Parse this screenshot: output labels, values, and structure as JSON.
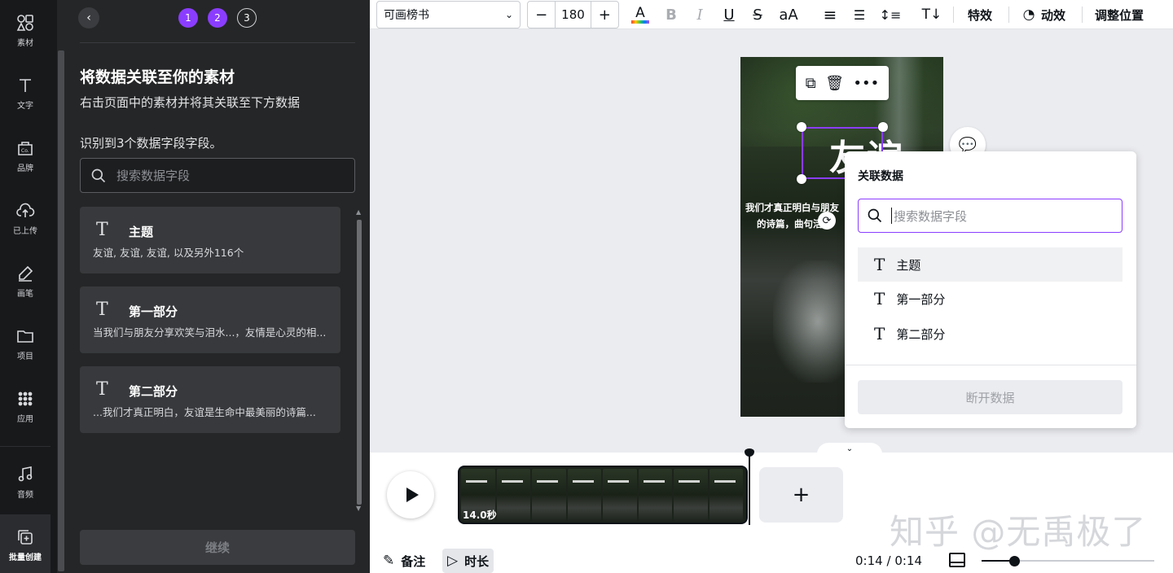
{
  "rail": {
    "items": [
      {
        "label": "素材",
        "icon": "elements-icon"
      },
      {
        "label": "文字",
        "icon": "text-icon"
      },
      {
        "label": "品牌",
        "icon": "brand-icon"
      },
      {
        "label": "已上传",
        "icon": "upload-icon"
      },
      {
        "label": "画笔",
        "icon": "draw-icon"
      },
      {
        "label": "项目",
        "icon": "folder-icon"
      },
      {
        "label": "应用",
        "icon": "apps-icon"
      },
      {
        "label": "音频",
        "icon": "music-icon"
      },
      {
        "label": "批量创建",
        "icon": "bulk-create-icon"
      }
    ]
  },
  "panel": {
    "steps": [
      "1",
      "2",
      "3"
    ],
    "current_step": 2,
    "title": "将数据关联至你的素材",
    "subtitle": "右击页面中的素材并将其关联至下方数据",
    "count_text": "识别到3个数据字段字段。",
    "search_placeholder": "搜索数据字段",
    "fields": [
      {
        "name": "主题",
        "values": "友谊, 友谊, 友谊, 以及另外116个"
      },
      {
        "name": "第一部分",
        "values": "当我们与朋友分享欢笑与泪水...，友情是心灵的相..."
      },
      {
        "name": "第二部分",
        "values": "...我们才真正明白，友谊是生命中最美丽的诗篇..."
      }
    ],
    "continue_label": "继续"
  },
  "toolbar": {
    "font_name": "可画榜书",
    "font_size": "180",
    "minus": "−",
    "plus": "+",
    "effects_label": "特效",
    "animate_label": "动效",
    "position_label": "调整位置"
  },
  "canvas": {
    "title_text": "友谊",
    "body_line1": "我们才真正明白与朋友",
    "body_line2": "的诗篇，曲句活"
  },
  "popup": {
    "title": "关联数据",
    "search_placeholder": "搜索数据字段",
    "items": [
      "主题",
      "第一部分",
      "第二部分"
    ],
    "disconnect_label": "断开数据"
  },
  "timeline": {
    "clip_duration": "14.0秒",
    "notes_label": "备注",
    "duration_label": "时长",
    "time_current": "0:14",
    "time_total": "0:14",
    "zoom_level": 0.19,
    "watermark": "知乎 @无禹极了"
  },
  "colors": {
    "accent": "#8b3dff",
    "rail_bg": "#18191b",
    "panel_bg": "#252627"
  }
}
